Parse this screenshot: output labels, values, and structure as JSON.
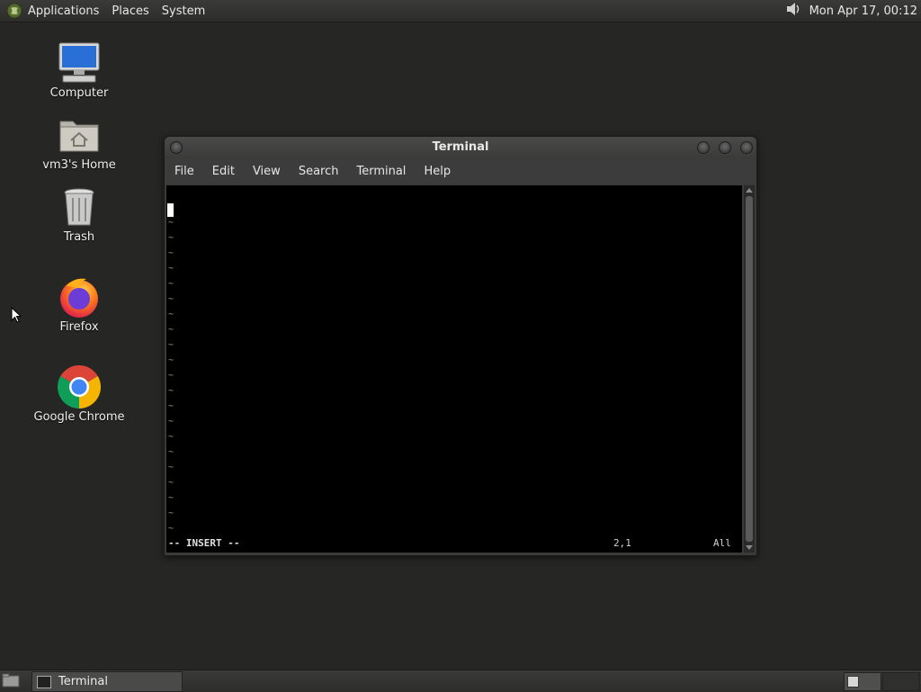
{
  "top_panel": {
    "menus": [
      "Applications",
      "Places",
      "System"
    ],
    "clock": "Mon Apr 17, 00:12",
    "volume_icon": "speaker-icon"
  },
  "desktop": {
    "icons": [
      {
        "label": "Computer",
        "icon": "computer-icon"
      },
      {
        "label": "vm3's Home",
        "icon": "home-folder-icon"
      },
      {
        "label": "Trash",
        "icon": "trash-icon"
      },
      {
        "label": "Firefox",
        "icon": "firefox-icon"
      },
      {
        "label": "Google Chrome",
        "icon": "chrome-icon"
      }
    ]
  },
  "window": {
    "title": "Terminal",
    "menu": [
      "File",
      "Edit",
      "View",
      "Search",
      "Terminal",
      "Help"
    ],
    "terminal": {
      "tilde_char": "~",
      "tilde_count": 21,
      "mode": "-- INSERT --",
      "position": "2,1",
      "scroll": "All"
    }
  },
  "taskbar": {
    "task_label": "Terminal"
  },
  "colors": {
    "desktop_bg": "#262624",
    "terminal_bg": "#000000",
    "panel_bg": "#333331"
  }
}
